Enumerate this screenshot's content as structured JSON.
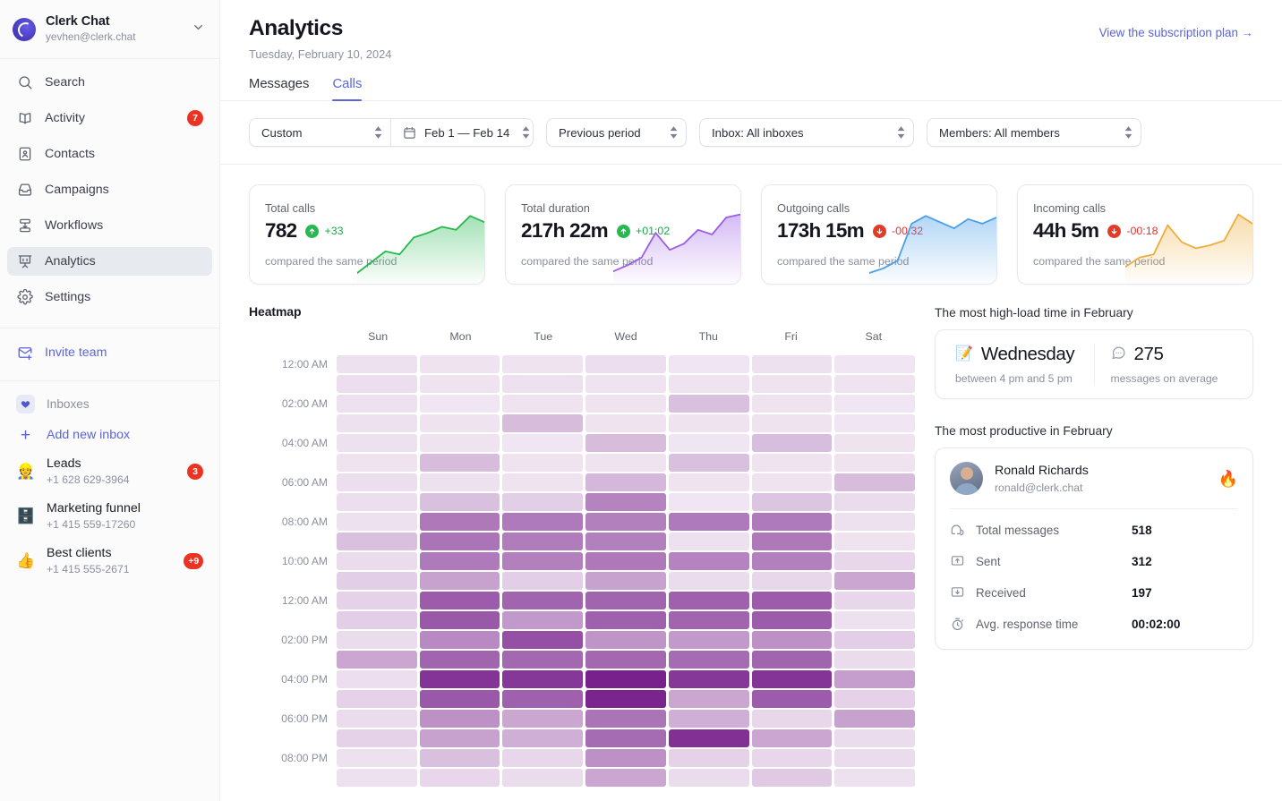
{
  "workspace": {
    "name": "Clerk Chat",
    "email": "yevhen@clerk.chat",
    "logo_icon": "clerk-logo-icon",
    "chevron_icon": "chevron-down-icon"
  },
  "sidebar": {
    "nav": [
      {
        "label": "Search",
        "icon": "search-icon",
        "badge": "",
        "active": false
      },
      {
        "label": "Activity",
        "icon": "activity-icon",
        "badge": "7",
        "active": false
      },
      {
        "label": "Contacts",
        "icon": "contacts-icon",
        "badge": "",
        "active": false
      },
      {
        "label": "Campaigns",
        "icon": "campaigns-icon",
        "badge": "",
        "active": false
      },
      {
        "label": "Workflows",
        "icon": "workflows-icon",
        "badge": "",
        "active": false
      },
      {
        "label": "Analytics",
        "icon": "analytics-icon",
        "badge": "",
        "active": true
      },
      {
        "label": "Settings",
        "icon": "gear-icon",
        "badge": "",
        "active": false
      }
    ],
    "invite_team": "Invite team",
    "inboxes_label": "Inboxes",
    "add_new_inbox": "Add new inbox",
    "inboxes": [
      {
        "emoji": "👷",
        "name": "Leads",
        "number": "+1 628 629-3964",
        "badge": "3"
      },
      {
        "emoji": "🗄️",
        "name": "Marketing funnel",
        "number": "+1 415 559-17260",
        "badge": ""
      },
      {
        "emoji": "👍",
        "name": "Best clients",
        "number": "+1 415 555-2671",
        "badge": "+9"
      }
    ]
  },
  "header": {
    "title": "Analytics",
    "date": "Tuesday, February 10, 2024",
    "subscription_link": "View the subscription plan →"
  },
  "tabs": [
    {
      "label": "Messages",
      "active": false
    },
    {
      "label": "Calls",
      "active": true
    }
  ],
  "filters": {
    "range_preset": "Custom",
    "date_range": "Feb 1 — Feb 14",
    "calendar_icon": "calendar-icon",
    "comparison": "Previous period",
    "inbox": "Inbox: All inboxes",
    "members": "Members: All members"
  },
  "kpis": [
    {
      "label": "Total calls",
      "value": "782",
      "delta": "+33",
      "direction": "up",
      "sub": "compared the same period",
      "color": "#25b94f",
      "spark": [
        86,
        72,
        58,
        62,
        40,
        34,
        26,
        30,
        12,
        20
      ]
    },
    {
      "label": "Total duration",
      "value": "217h 22m",
      "delta": "+01:02",
      "direction": "up",
      "sub": "compared the same period",
      "color": "#9b5de5",
      "spark": [
        84,
        76,
        66,
        34,
        56,
        48,
        30,
        36,
        14,
        10
      ]
    },
    {
      "label": "Outgoing calls",
      "value": "173h 15m",
      "delta": "-00:32",
      "direction": "down",
      "sub": "compared the same period",
      "color": "#4a9fe8",
      "spark": [
        86,
        80,
        70,
        22,
        12,
        20,
        28,
        16,
        22,
        14
      ]
    },
    {
      "label": "Incoming calls",
      "value": "44h 5m",
      "delta": "-00:18",
      "direction": "down",
      "sub": "compared the same period",
      "color": "#eead3a",
      "spark": [
        78,
        66,
        62,
        24,
        46,
        54,
        50,
        44,
        10,
        22
      ]
    }
  ],
  "heatmap": {
    "title": "Heatmap",
    "days": [
      "Sun",
      "Mon",
      "Tue",
      "Wed",
      "Thu",
      "Fri",
      "Sat"
    ],
    "time_labels": [
      "12:00 AM",
      "02:00 AM",
      "04:00 AM",
      "06:00 AM",
      "08:00 AM",
      "10:00 AM",
      "12:00 AM",
      "02:00 PM",
      "04:00 PM",
      "06:00 PM",
      "08:00 PM"
    ],
    "base_color": "#8e2f9e",
    "values": [
      [
        0.08,
        0.07,
        0.07,
        0.09,
        0.06,
        0.08,
        0.06
      ],
      [
        0.09,
        0.07,
        0.08,
        0.07,
        0.07,
        0.07,
        0.07
      ],
      [
        0.08,
        0.06,
        0.07,
        0.07,
        0.22,
        0.07,
        0.06
      ],
      [
        0.08,
        0.07,
        0.24,
        0.07,
        0.07,
        0.07,
        0.06
      ],
      [
        0.08,
        0.07,
        0.06,
        0.24,
        0.06,
        0.23,
        0.07
      ],
      [
        0.07,
        0.24,
        0.07,
        0.07,
        0.22,
        0.07,
        0.07
      ],
      [
        0.09,
        0.08,
        0.07,
        0.26,
        0.07,
        0.07,
        0.24
      ],
      [
        0.09,
        0.22,
        0.16,
        0.5,
        0.06,
        0.2,
        0.1
      ],
      [
        0.08,
        0.56,
        0.55,
        0.52,
        0.55,
        0.55,
        0.08
      ],
      [
        0.22,
        0.58,
        0.54,
        0.52,
        0.08,
        0.56,
        0.07
      ],
      [
        0.1,
        0.55,
        0.52,
        0.56,
        0.5,
        0.52,
        0.12
      ],
      [
        0.16,
        0.36,
        0.16,
        0.36,
        0.1,
        0.12,
        0.34
      ],
      [
        0.14,
        0.7,
        0.66,
        0.66,
        0.68,
        0.7,
        0.12
      ],
      [
        0.16,
        0.72,
        0.4,
        0.68,
        0.66,
        0.7,
        0.08
      ],
      [
        0.1,
        0.48,
        0.76,
        0.42,
        0.4,
        0.44,
        0.16
      ],
      [
        0.34,
        0.66,
        0.64,
        0.64,
        0.62,
        0.66,
        0.1
      ],
      [
        0.09,
        0.9,
        0.88,
        1.0,
        0.88,
        0.9,
        0.38
      ],
      [
        0.14,
        0.72,
        0.68,
        0.98,
        0.34,
        0.7,
        0.14
      ],
      [
        0.1,
        0.44,
        0.34,
        0.58,
        0.3,
        0.12,
        0.36
      ],
      [
        0.14,
        0.36,
        0.3,
        0.62,
        0.92,
        0.34,
        0.1
      ],
      [
        0.08,
        0.22,
        0.12,
        0.44,
        0.14,
        0.12,
        0.1
      ],
      [
        0.08,
        0.12,
        0.1,
        0.34,
        0.1,
        0.18,
        0.08
      ]
    ]
  },
  "high_load": {
    "panel_title": "The most high-load time in February",
    "day_emoji": "📝",
    "day": "Wednesday",
    "day_sub": "between 4 pm and 5 pm",
    "count_icon": "message-bubble-icon",
    "count": "275",
    "count_sub": "messages on average"
  },
  "productive": {
    "panel_title": "The most productive in February",
    "name": "Ronald Richards",
    "email": "ronald@clerk.chat",
    "fire_emoji": "🔥",
    "stats": [
      {
        "icon": "messages-icon",
        "label": "Total messages",
        "value": "518"
      },
      {
        "icon": "sent-icon",
        "label": "Sent",
        "value": "312"
      },
      {
        "icon": "received-icon",
        "label": "Received",
        "value": "197"
      },
      {
        "icon": "stopwatch-icon",
        "label": "Avg. response time",
        "value": "00:02:00"
      }
    ]
  }
}
